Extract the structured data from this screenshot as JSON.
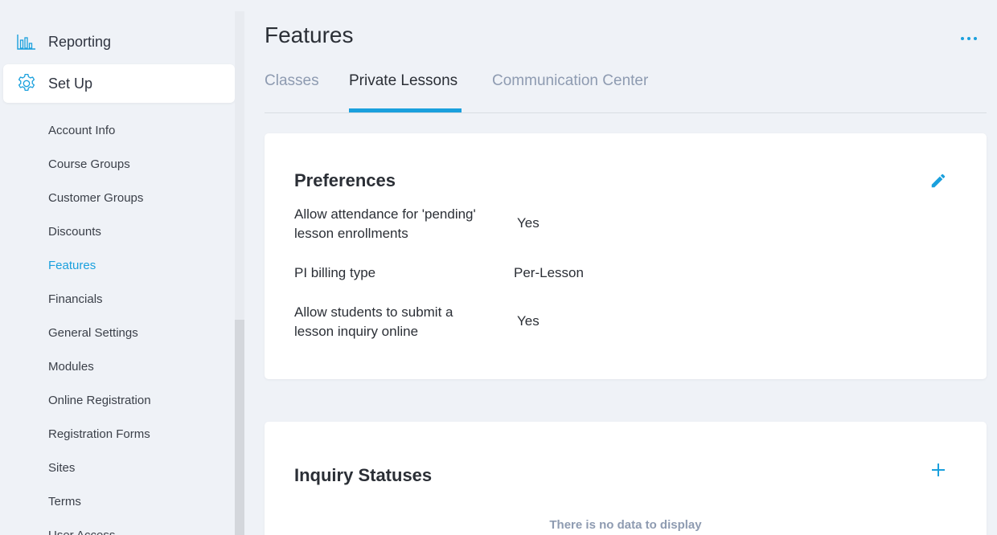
{
  "sidebar": {
    "reporting": {
      "label": "Reporting",
      "icon": "bar-chart-icon"
    },
    "setup": {
      "label": "Set Up",
      "icon": "gear-icon"
    },
    "items": [
      {
        "label": "Account Info"
      },
      {
        "label": "Course Groups"
      },
      {
        "label": "Customer Groups"
      },
      {
        "label": "Discounts"
      },
      {
        "label": "Features",
        "active": true
      },
      {
        "label": "Financials"
      },
      {
        "label": "General Settings"
      },
      {
        "label": "Modules"
      },
      {
        "label": "Online Registration"
      },
      {
        "label": "Registration Forms"
      },
      {
        "label": "Sites"
      },
      {
        "label": "Terms"
      },
      {
        "label": "User Access"
      }
    ]
  },
  "header": {
    "title": "Features",
    "more_icon": "more-horizontal-icon"
  },
  "tabs": [
    {
      "label": "Classes"
    },
    {
      "label": "Private Lessons",
      "active": true
    },
    {
      "label": "Communication Center"
    }
  ],
  "preferences": {
    "title": "Preferences",
    "edit_icon": "pencil-icon",
    "rows": [
      {
        "label": "Allow attendance for 'pending' lesson enrollments",
        "value": "Yes"
      },
      {
        "label": "PI billing type",
        "value": "Per-Lesson"
      },
      {
        "label": "Allow students to submit a lesson inquiry online",
        "value": "Yes"
      }
    ]
  },
  "inquiry": {
    "title": "Inquiry Statuses",
    "add_icon": "plus-icon",
    "empty_message": "There is no data to display"
  },
  "colors": {
    "accent": "#1aa0dd",
    "background": "#eff2f7",
    "muted_text": "#8e9bb1"
  }
}
